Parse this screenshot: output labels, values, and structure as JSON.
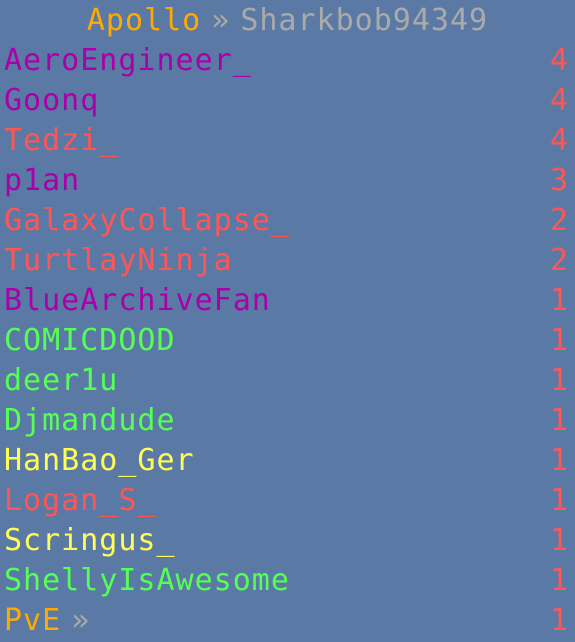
{
  "header": {
    "server": "Apollo",
    "separator": "»",
    "player": "Sharkbob94349"
  },
  "colors": {
    "background": "#5a7aa5",
    "gold": "#ffaa00",
    "gray": "#aaaaaa",
    "red": "#ff5555",
    "purple": "#aa00aa",
    "green": "#55ff55",
    "yellow": "#ffff55"
  },
  "rows": [
    {
      "name": "AeroEngineer_",
      "score": "4",
      "color": "#aa00aa"
    },
    {
      "name": "Goonq",
      "score": "4",
      "color": "#aa00aa"
    },
    {
      "name": "Tedzi_",
      "score": "4",
      "color": "#ff5555"
    },
    {
      "name": "p1an",
      "score": "3",
      "color": "#aa00aa"
    },
    {
      "name": "GalaxyCollapse_",
      "score": "2",
      "color": "#ff5555"
    },
    {
      "name": "TurtlayNinja",
      "score": "2",
      "color": "#ff5555"
    },
    {
      "name": "BlueArchiveFan",
      "score": "1",
      "color": "#aa00aa"
    },
    {
      "name": "COMICDOOD",
      "score": "1",
      "color": "#55ff55"
    },
    {
      "name": "deer1u",
      "score": "1",
      "color": "#55ff55"
    },
    {
      "name": "Djmandude",
      "score": "1",
      "color": "#55ff55"
    },
    {
      "name": "HanBao_Ger",
      "score": "1",
      "color": "#ffff55"
    },
    {
      "name": "Logan_S_",
      "score": "1",
      "color": "#ff5555"
    },
    {
      "name": "Scringus_",
      "score": "1",
      "color": "#ffff55"
    },
    {
      "name": "ShellyIsAwesome",
      "score": "1",
      "color": "#55ff55"
    },
    {
      "name": "PvE",
      "score": "1",
      "color": "#ffaa00",
      "suffix": "»"
    }
  ]
}
